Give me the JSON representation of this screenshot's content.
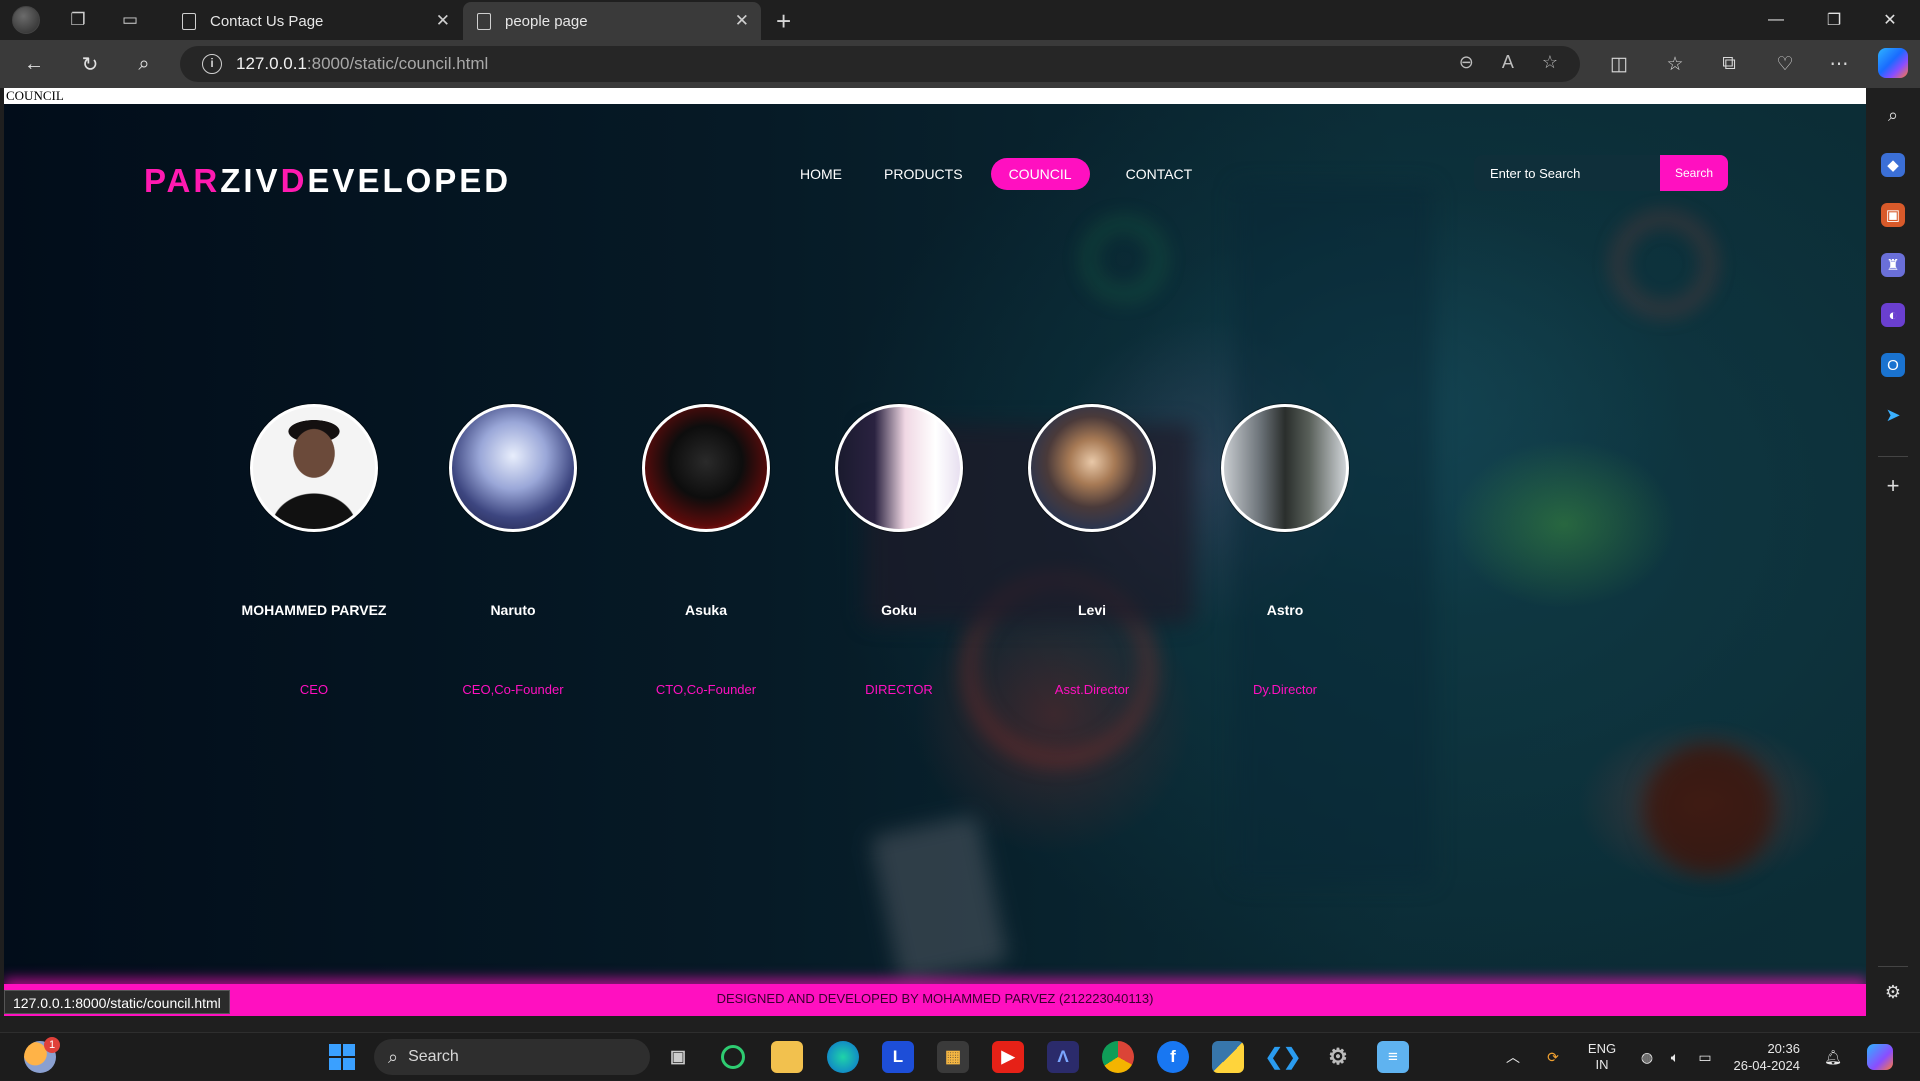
{
  "browser": {
    "tabs": [
      {
        "label": "Contact Us Page"
      },
      {
        "label": "people page"
      }
    ],
    "url_host": "127.0.0.1",
    "url_rest": ":8000/static/council.html",
    "status_url": "127.0.0.1:8000/static/council.html"
  },
  "page": {
    "document_title_text": "COUNCIL",
    "brand": {
      "p1": "PAR",
      "p2": "ZIV",
      "p3": "D",
      "p4": "EVELOPED"
    },
    "nav": [
      {
        "label": "HOME",
        "active": false
      },
      {
        "label": "PRODUCTS",
        "active": false
      },
      {
        "label": "COUNCIL",
        "active": true
      },
      {
        "label": "CONTACT",
        "active": false
      }
    ],
    "search": {
      "placeholder": "Enter to Search",
      "button": "Search"
    },
    "members": [
      {
        "name": "MOHAMMED PARVEZ",
        "role": "CEO"
      },
      {
        "name": "Naruto",
        "role": "CEO,Co-Founder"
      },
      {
        "name": "Asuka",
        "role": "CTO,Co-Founder"
      },
      {
        "name": "Goku",
        "role": "DIRECTOR"
      },
      {
        "name": "Levi",
        "role": "Asst.Director"
      },
      {
        "name": "Astro",
        "role": "Dy.Director"
      }
    ],
    "footer": "DESIGNED AND DEVELOPED BY MOHAMMED PARVEZ (212223040113)"
  },
  "taskbar": {
    "search_label": "Search",
    "weather_badge": "1",
    "lang": "ENG",
    "region": "IN",
    "time": "20:36",
    "date": "26-04-2024"
  },
  "colors": {
    "accent": "#ff10c0",
    "bg_dark": "#061a26"
  }
}
